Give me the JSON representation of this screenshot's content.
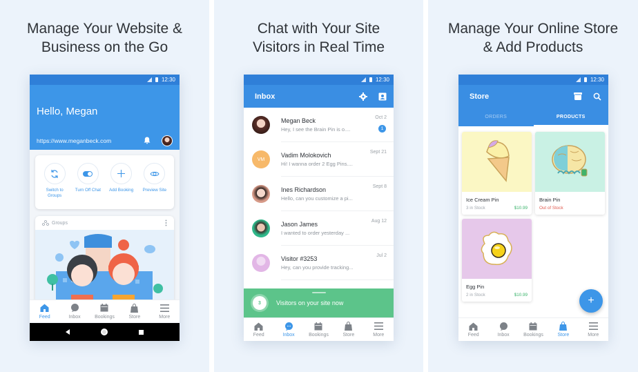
{
  "panels": [
    {
      "headline": [
        "Manage Your Website &",
        "Business on the Go"
      ],
      "status_time": "12:30",
      "greeting": "Hello, Megan",
      "site_url": "https://www.meganbeck.com",
      "quick_actions": [
        {
          "icon": "sync-icon",
          "label": "Switch to Groups"
        },
        {
          "icon": "toggle-icon",
          "label": "Turn Off Chat"
        },
        {
          "icon": "plus-icon",
          "label": "Add Booking"
        },
        {
          "icon": "eye-icon",
          "label": "Preview Site"
        }
      ],
      "groups_card_title": "Groups",
      "nav": [
        {
          "label": "Feed",
          "icon": "home-icon",
          "active": true
        },
        {
          "label": "Inbox",
          "icon": "chat-bubble-icon",
          "active": false
        },
        {
          "label": "Bookings",
          "icon": "calendar-icon",
          "active": false
        },
        {
          "label": "Store",
          "icon": "shopping-bag-icon",
          "active": false
        },
        {
          "label": "More",
          "icon": "menu-icon",
          "active": false
        }
      ]
    },
    {
      "headline": [
        "Chat with Your Site",
        "Visitors in Real Time"
      ],
      "status_time": "12:30",
      "title": "Inbox",
      "conversations": [
        {
          "name": "Megan Beck",
          "preview": "Hey, I see the Brain Pin is o....",
          "date": "Oct 2",
          "unread": "1",
          "avatar_color": "#d9b8aa"
        },
        {
          "name": "Vadim Molokovich",
          "preview": "Hi! I wanna order 2 Egg Pins....",
          "date": "Sept 21",
          "initials": "VM",
          "avatar_color": "#f7b96a"
        },
        {
          "name": "Ines Richardson",
          "preview": "Hello, can you customize a pi...",
          "date": "Sept 8",
          "avatar_color": "#d79a88"
        },
        {
          "name": "Jason James",
          "preview": "I wanted to order yesterday ...",
          "date": "Aug 12",
          "avatar_color": "#2fb88a"
        },
        {
          "name": "Visitor #3253",
          "preview": "Hey, can you provide tracking...",
          "date": "Jul 2",
          "avatar_color": "#e2b6e6"
        }
      ],
      "visitors_count": "3",
      "visitors_label": "Visitors on your site now",
      "nav": [
        {
          "label": "Feed",
          "icon": "home-icon",
          "active": false
        },
        {
          "label": "Inbox",
          "icon": "chat-bubble-icon",
          "active": true
        },
        {
          "label": "Bookings",
          "icon": "calendar-icon",
          "active": false
        },
        {
          "label": "Store",
          "icon": "shopping-bag-icon",
          "active": false
        },
        {
          "label": "More",
          "icon": "menu-icon",
          "active": false
        }
      ]
    },
    {
      "headline": [
        "Manage Your Online Store",
        "& Add Products"
      ],
      "status_time": "12:30",
      "title": "Store",
      "tabs": [
        {
          "label": "ORDERS",
          "active": false
        },
        {
          "label": "PRODUCTS",
          "active": true
        }
      ],
      "products": [
        {
          "name": "Ice Cream Pin",
          "stock": "3 in Stock",
          "price": "$10.99",
          "bg": "#fbf7c4",
          "out_of_stock": false
        },
        {
          "name": "Brain Pin",
          "stock": "Out of Stock",
          "price": "",
          "bg": "#c9f1e4",
          "out_of_stock": true
        },
        {
          "name": "Egg Pin",
          "stock": "2 in Stock",
          "price": "$10.99",
          "bg": "#e6c8ea",
          "out_of_stock": false
        }
      ],
      "fab_label": "+",
      "nav": [
        {
          "label": "Feed",
          "icon": "home-icon",
          "active": false
        },
        {
          "label": "Inbox",
          "icon": "chat-bubble-icon",
          "active": false
        },
        {
          "label": "Bookings",
          "icon": "calendar-icon",
          "active": false
        },
        {
          "label": "Store",
          "icon": "shopping-bag-icon",
          "active": true
        },
        {
          "label": "More",
          "icon": "menu-icon",
          "active": false
        }
      ]
    }
  ],
  "colors": {
    "primary": "#3d96e8",
    "statusbar": "#2f7fd8",
    "green": "#5cc48a",
    "price_green": "#3ab36b",
    "out_of_stock_red": "#e05a4f",
    "panel_bg": "#ecf3fb"
  }
}
